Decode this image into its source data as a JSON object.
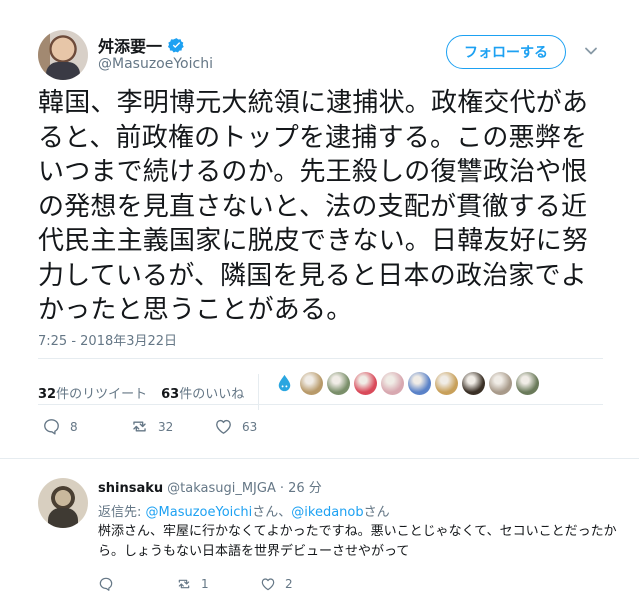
{
  "tweet": {
    "display_name": "舛添要一",
    "handle": "@MasuzoeYoichi",
    "follow_label": "フォローする",
    "text": "韓国、李明博元大統領に逮捕状。政権交代があると、前政権のトップを逮捕する。この悪弊をいつまで続けるのか。先王殺しの復讐政治や恨の発想を見直さないと、法の支配が貫徹する近代民主主義国家に脱皮できない。日韓友好に努力しているが、隣国を見ると日本の政治家でよかったと思うことがある。",
    "timestamp": "7:25 - 2018年3月22日",
    "retweets_count": "32",
    "retweets_label": "件のリツイート",
    "likes_count": "63",
    "likes_label": "件のいいね",
    "reply_count": "8",
    "retweet_count": "32",
    "like_count": "63"
  },
  "likers": [
    {
      "icon": "water-drop-avatar",
      "color": "#2aa6e0"
    },
    {
      "icon": "food-avatar",
      "color": "#b89a6a"
    },
    {
      "icon": "character-avatar",
      "color": "#7a8f6a"
    },
    {
      "icon": "flower-avatar",
      "color": "#d94a5a"
    },
    {
      "icon": "anime-avatar",
      "color": "#d8a8b0"
    },
    {
      "icon": "tree-avatar",
      "color": "#5a82c8"
    },
    {
      "icon": "flower-bouquet-avatar",
      "color": "#c8a05a"
    },
    {
      "icon": "dark-avatar",
      "color": "#3a3026"
    },
    {
      "icon": "animal-avatar",
      "color": "#a89a8a"
    },
    {
      "icon": "landscape-avatar",
      "color": "#6a7a5a"
    }
  ],
  "reply": {
    "name": "shinsaku",
    "handle": "@takasugi_MJGA",
    "time": "· 26 分",
    "replying_prefix": "返信先: ",
    "mention1": "@MasuzoeYoichi",
    "mention_sep": "さん、",
    "mention2": "@ikedanob",
    "mention_suffix": "さん",
    "text": "桝添さん、牢屋に行かなくてよかったですね。悪いことじゃなくて、セコいことだったから。しょうもない日本語を世界デビューさせやがって",
    "retweet_count": "1",
    "like_count": "2"
  },
  "colors": {
    "accent": "#1da1f2",
    "secondary_text": "#657786",
    "primary_text": "#14171a"
  }
}
